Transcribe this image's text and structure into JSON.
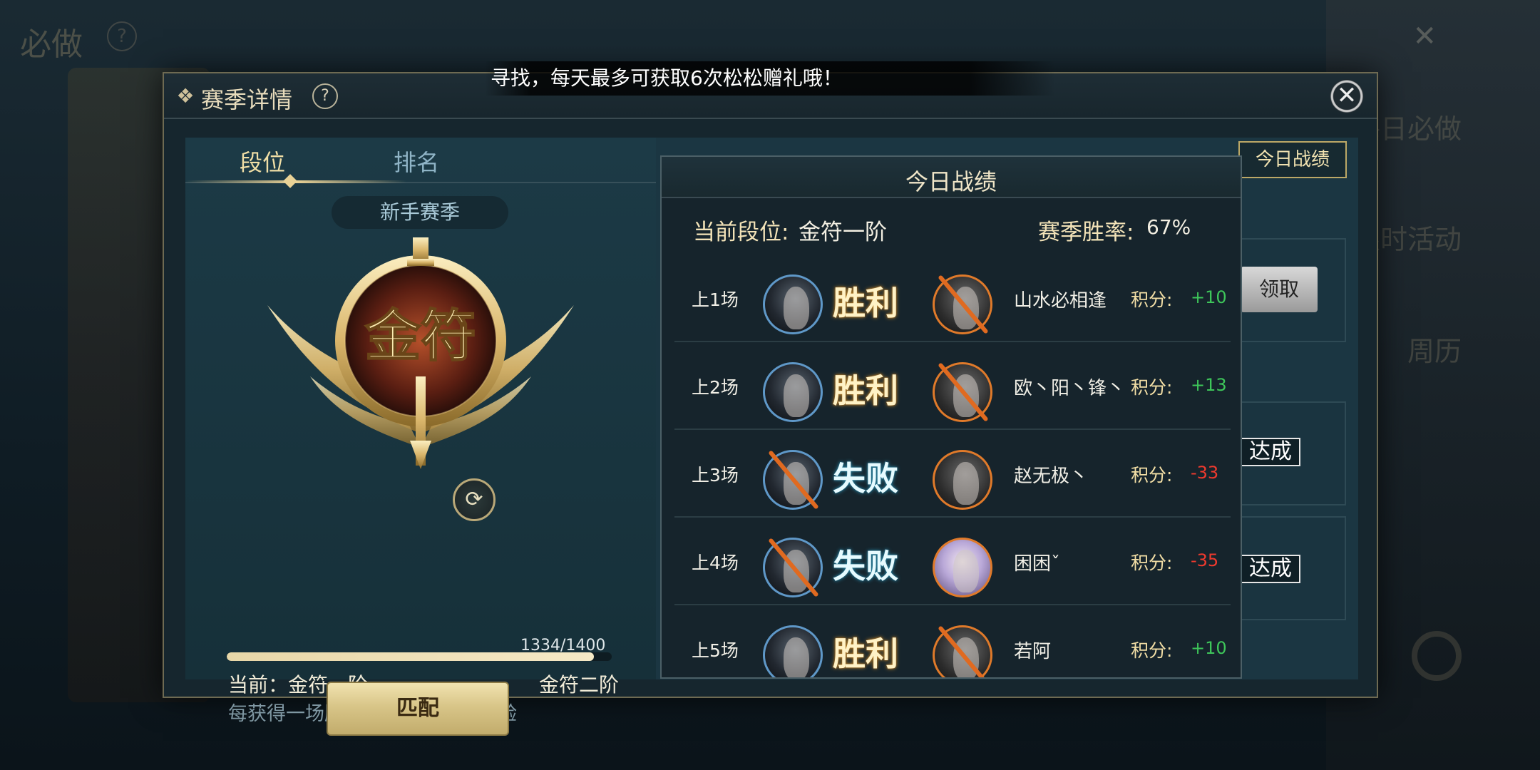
{
  "background": {
    "title": "必做",
    "side_items": [
      "每日必做",
      "限时活动",
      "周历"
    ],
    "peek_claim": "领取",
    "peek_status": "达成"
  },
  "marquee": "寻找，每天最多可获取6次松松赠礼哦！",
  "dialog": {
    "title": "赛季详情",
    "help": "?",
    "close": "✕"
  },
  "tabs": {
    "rank": "段位",
    "ranking": "排名"
  },
  "season": "新手赛季",
  "emblem_text": "金符",
  "progress": {
    "text": "1334/1400",
    "current": 1334,
    "max": 1400
  },
  "current_rank_label": "当前：金符一阶",
  "next_rank_label": "金符二阶",
  "hint": "每获得一场胜利，可获得段位经验",
  "match_button": "匹配",
  "today_tab": "今日战绩",
  "popup": {
    "title": "今日战绩",
    "rank_label": "当前段位:",
    "rank_value": "金符一阶",
    "winrate_label": "赛季胜率:",
    "winrate_value": "67%",
    "score_label": "积分:",
    "matches": [
      {
        "label": "上1场",
        "result": "胜利",
        "win": true,
        "opponent": "山水必相逢",
        "score": "+10"
      },
      {
        "label": "上2场",
        "result": "胜利",
        "win": true,
        "opponent": "欧丶阳丶锋丶",
        "score": "+13"
      },
      {
        "label": "上3场",
        "result": "失败",
        "win": false,
        "opponent": "赵无极丶",
        "score": "-33"
      },
      {
        "label": "上4场",
        "result": "失败",
        "win": false,
        "opponent": "困困ˇ",
        "score": "-35"
      },
      {
        "label": "上5场",
        "result": "胜利",
        "win": true,
        "opponent": "若阿",
        "score": "+10"
      }
    ]
  },
  "colors": {
    "win": "#fff2c6",
    "lose": "#e6fbff",
    "score_pos": "#3ec65a",
    "score_neg": "#ef3a2e",
    "accent_gold": "#e9d296"
  }
}
